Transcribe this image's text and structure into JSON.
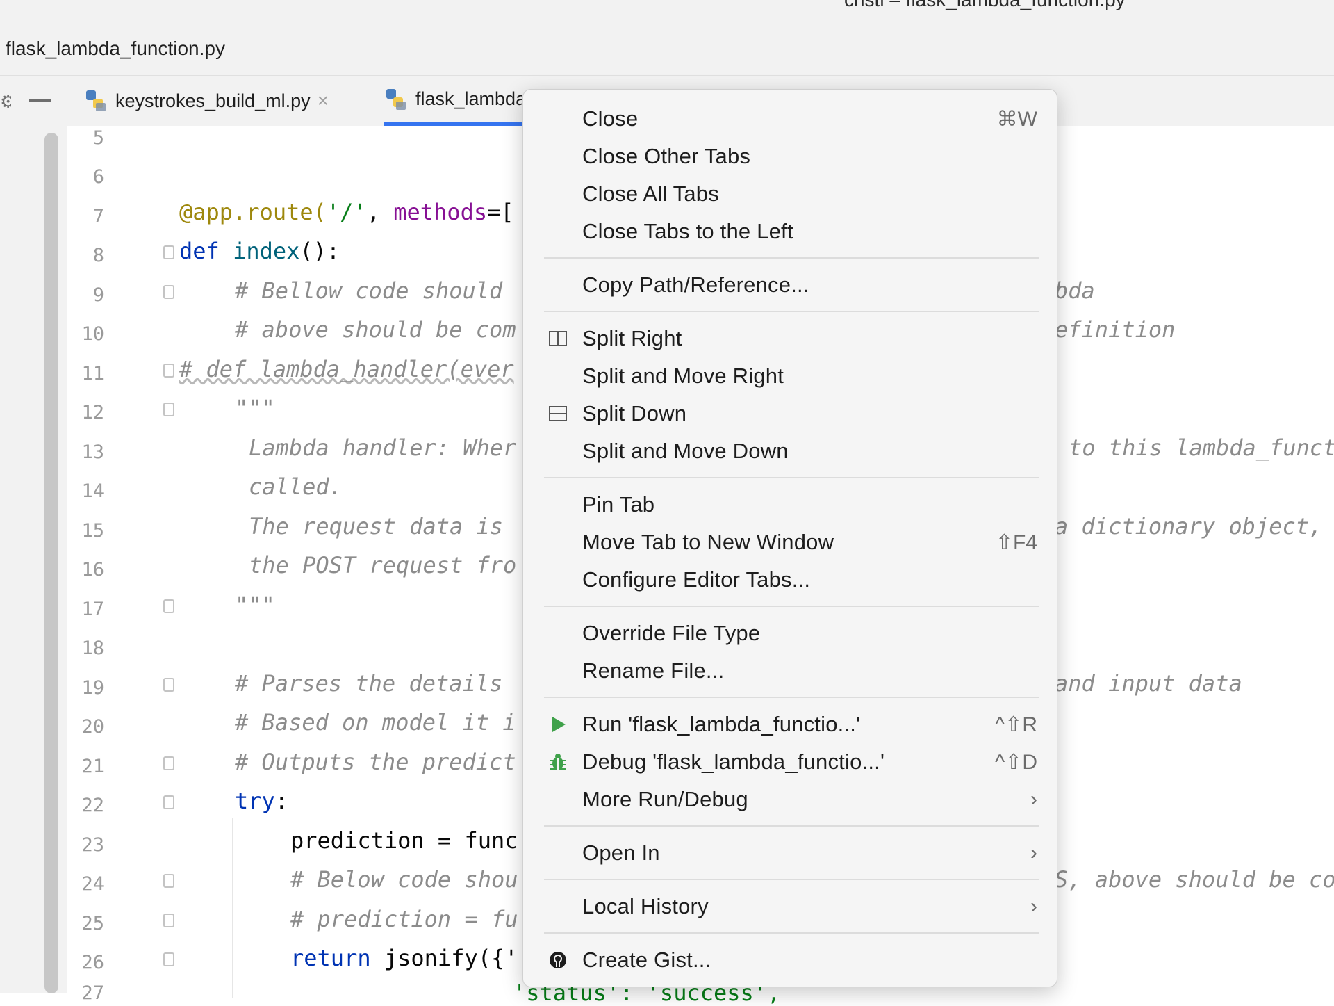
{
  "window": {
    "title": "cristi – flask_lambda_function.py"
  },
  "navbar": {
    "file": "flask_lambda_function.py"
  },
  "tabs": [
    {
      "label": "keystrokes_build_ml.py",
      "active": false
    },
    {
      "label": "flask_lambda_function.py",
      "active": true
    }
  ],
  "editor": {
    "line_numbers": [
      "5",
      "6",
      "7",
      "8",
      "9",
      "10",
      "11",
      "12",
      "13",
      "14",
      "15",
      "16",
      "17",
      "18",
      "19",
      "20",
      "21",
      "22",
      "23",
      "24",
      "25",
      "26",
      "27"
    ],
    "code": {
      "l7": {
        "deco": "@app.route(",
        "str": "'/'",
        "sep": ", ",
        "param": "methods",
        "rest": "=["
      },
      "l8": {
        "kw": "def ",
        "fn": "index",
        "rest": "():"
      },
      "l9": "# Bellow code should ",
      "l9r": "bda",
      "l10": "# above should be com",
      "l10r": "efinition",
      "l11": "# def lambda_handler(ever",
      "l12": "\"\"\"",
      "l13": "Lambda handler: Wher",
      "l13r": "to this lambda_funct",
      "l14": "called.",
      "l15": "The request data is ",
      "l15r": "a dictionary object,",
      "l16": "the POST request fro",
      "l17": "\"\"\"",
      "l19": "# Parses the details ",
      "l19r": "and input data",
      "l20": "# Based on model it i",
      "l21": "# Outputs the predict",
      "l22": {
        "kw": "try",
        "rest": ":"
      },
      "l23": "prediction = func",
      "l24": "# Below code shou",
      "l24r": "S, above should be co",
      "l25": "# prediction = fu",
      "l26": {
        "kw": "return ",
        "rest": "jsonify({'"
      },
      "l27": "'status': 'success',"
    }
  },
  "context_menu": {
    "groups": [
      [
        {
          "label": "Close",
          "shortcut": "⌘W"
        },
        {
          "label": "Close Other Tabs",
          "shortcut": ""
        },
        {
          "label": "Close All Tabs",
          "shortcut": ""
        },
        {
          "label": "Close Tabs to the Left",
          "shortcut": ""
        }
      ],
      [
        {
          "label": "Copy Path/Reference...",
          "shortcut": ""
        }
      ],
      [
        {
          "label": "Split Right",
          "shortcut": "",
          "icon": "split-right-icon"
        },
        {
          "label": "Split and Move Right",
          "shortcut": ""
        },
        {
          "label": "Split Down",
          "shortcut": "",
          "icon": "split-down-icon"
        },
        {
          "label": "Split and Move Down",
          "shortcut": ""
        }
      ],
      [
        {
          "label": "Pin Tab",
          "shortcut": ""
        },
        {
          "label": "Move Tab to New Window",
          "shortcut": "⇧F4"
        },
        {
          "label": "Configure Editor Tabs...",
          "shortcut": ""
        }
      ],
      [
        {
          "label": "Override File Type",
          "shortcut": ""
        },
        {
          "label": "Rename File...",
          "shortcut": ""
        }
      ],
      [
        {
          "label": "Run 'flask_lambda_functio...'",
          "shortcut": "^⇧R",
          "icon": "run-icon"
        },
        {
          "label": "Debug 'flask_lambda_functio...'",
          "shortcut": "^⇧D",
          "icon": "debug-icon"
        },
        {
          "label": "More Run/Debug",
          "shortcut": "›"
        }
      ],
      [
        {
          "label": "Open In",
          "shortcut": "›"
        }
      ],
      [
        {
          "label": "Local History",
          "shortcut": "›"
        }
      ],
      [
        {
          "label": "Create Gist...",
          "shortcut": "",
          "icon": "github-icon"
        }
      ]
    ]
  },
  "colors": {
    "accent": "#3574f0",
    "run_green": "#3fa14a",
    "keyword": "#0033b3",
    "comment": "#8c8c8c",
    "string": "#067d17"
  }
}
